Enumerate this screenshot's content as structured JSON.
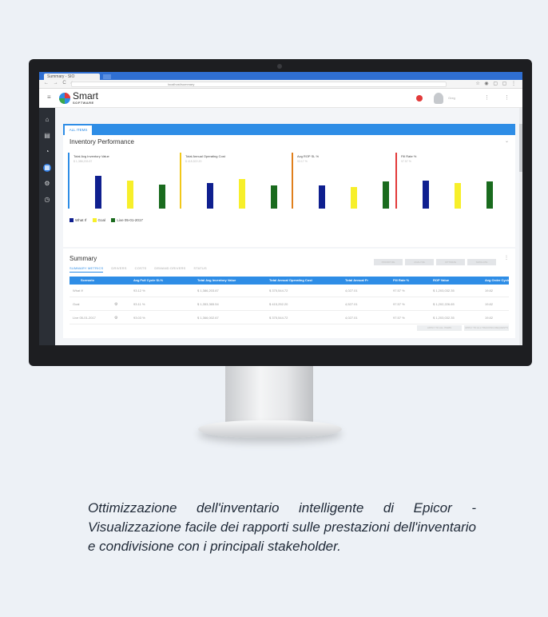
{
  "browser": {
    "tab_title": "Summary - SIO",
    "url": "localhost/summary",
    "nav_glyphs": "← → C ⌂",
    "right_glyphs": "☆ ◉ ▢ ▢ ⋮"
  },
  "app": {
    "logo_text": "Smart",
    "logo_sub": "SOFTWARE",
    "user_name": "Greg",
    "menu_glyphs": "⋮ ⋮"
  },
  "rail": {
    "icons": [
      "home-icon",
      "box-icon",
      "gauge-icon",
      "grid-icon",
      "gear-icon",
      "clock-icon"
    ]
  },
  "tabs": {
    "all_items": "ALL ITEMS"
  },
  "performance": {
    "title": "Inventory Performance",
    "caret": "⌄",
    "kpis": [
      {
        "title": "Total Avg Inventory Value",
        "sub": "$ 1,386,203.87",
        "color": "#2e8de6",
        "values": [
          0.78,
          0.68,
          0.58
        ]
      },
      {
        "title": "Total Annual Operating Cost",
        "sub": "$ 415,522.20",
        "color": "#f2c81a",
        "values": [
          0.62,
          0.72,
          0.55
        ]
      },
      {
        "title": "Avg ROP SL %",
        "sub": "93.17 %",
        "color": "#e07f1c",
        "values": [
          0.55,
          0.52,
          0.65
        ]
      },
      {
        "title": "Fill Rate %",
        "sub": "97.57 %",
        "color": "#e23a3a",
        "values": [
          0.68,
          0.62,
          0.66
        ]
      }
    ],
    "series_colors": [
      "#0f1f8f",
      "#f7ef2a",
      "#1a6b1e"
    ],
    "legend": [
      "What If",
      "Goal",
      "Live 05-01-2017"
    ]
  },
  "summary": {
    "title": "Summary",
    "actions": [
      "PRIORITIZE",
      "ANALYZE",
      "OPTIMIZE",
      "SIMULATE"
    ],
    "more": "⋮",
    "subtabs": [
      "SUMMARY METRICS",
      "DRIVERS",
      "COSTS",
      "DEMAND DRIVERS",
      "STATUS"
    ],
    "headers": [
      "Scenario",
      "Avg Full Cycle SL%",
      "Total Avg Inventory Value",
      "Total Annual Operating Cost",
      "Total Annual Fr",
      "Fill Rate %",
      "ROP Value",
      "Avg Order Cycle"
    ],
    "rows": [
      {
        "cells": [
          "What If",
          "93.12 %",
          "$ 1,386,203.87",
          "$ 375,544.72",
          "4,027.01",
          "97.57 %",
          "$ 1,203,032.35",
          "19.82"
        ],
        "gear": false
      },
      {
        "cells": [
          "Goal",
          "93.11 %",
          "$ 1,353,365.54",
          "$ 415,252.20",
          "4,527.01",
          "97.57 %",
          "$ 1,202,226.65",
          "19.82"
        ],
        "gear": true
      },
      {
        "cells": [
          "Live 05-01-2017",
          "93.03 %",
          "$ 1,366,002.67",
          "$ 375,544.72",
          "4,027.01",
          "97.57 %",
          "$ 1,203,032.35",
          "19.82"
        ],
        "gear": true
      }
    ],
    "gear_glyph": "⚙",
    "footer_buttons": [
      "APPLY TO ALL ITEMS",
      "APPLY TO ALL TRACKING REQUESTS"
    ]
  },
  "caption": "Ottimizzazione dell'inventario intelligente di Epicor - Visualizzazione facile dei rapporti sulle prestazioni dell'inventario e condivisione con i principali stakeholder."
}
